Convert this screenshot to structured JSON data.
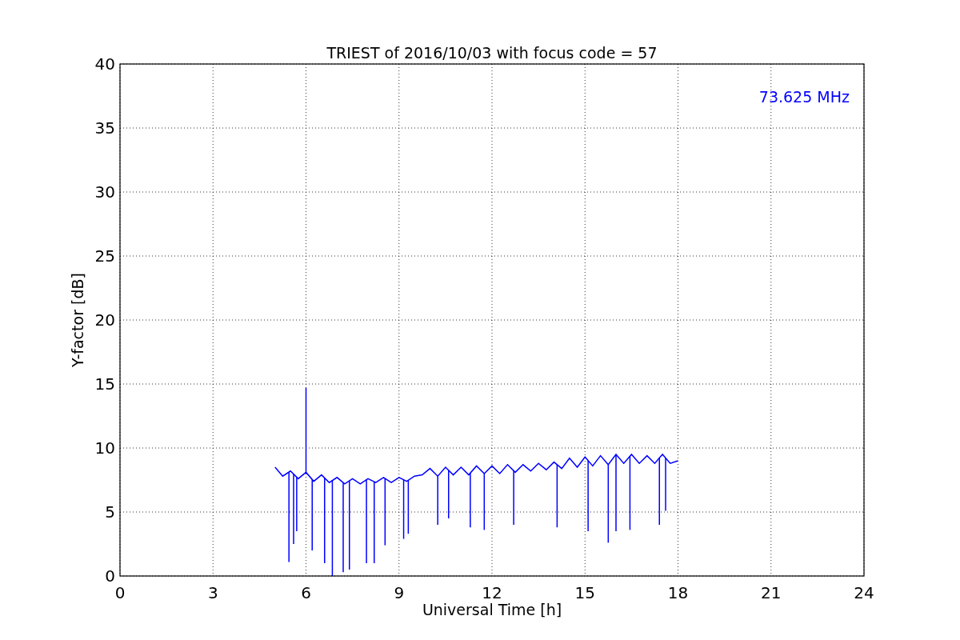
{
  "chart_data": {
    "type": "line",
    "title": "TRIEST of 2016/10/03 with focus code = 57",
    "xlabel": "Universal Time [h]",
    "ylabel": "Y-factor [dB]",
    "xlim": [
      0,
      24
    ],
    "ylim": [
      0,
      40
    ],
    "xticks": [
      0,
      3,
      6,
      9,
      12,
      15,
      18,
      21,
      24
    ],
    "yticks": [
      0,
      5,
      10,
      15,
      20,
      25,
      30,
      35,
      40
    ],
    "grid": true,
    "x": [
      5,
      5.25,
      5.5,
      5.75,
      6,
      6.25,
      6.5,
      6.75,
      7,
      7.25,
      7.5,
      7.75,
      8,
      8.25,
      8.5,
      8.75,
      9,
      9.25,
      9.5,
      9.75,
      10,
      10.25,
      10.5,
      10.75,
      11,
      11.25,
      11.5,
      11.75,
      12,
      12.25,
      12.5,
      12.75,
      13,
      13.25,
      13.5,
      13.75,
      14,
      14.25,
      14.5,
      14.75,
      15,
      15.25,
      15.5,
      15.75,
      16,
      16.25,
      16.5,
      16.75,
      17,
      17.25,
      17.5,
      17.75,
      18
    ],
    "series": [
      {
        "name": "73.625 MHz",
        "color": "#0000ff",
        "values": [
          8.5,
          7.8,
          8.2,
          7.6,
          8.1,
          7.4,
          7.9,
          7.3,
          7.7,
          7.2,
          7.6,
          7.2,
          7.6,
          7.3,
          7.7,
          7.3,
          7.7,
          7.4,
          7.8,
          7.9,
          8.4,
          7.8,
          8.5,
          7.9,
          8.5,
          7.9,
          8.6,
          8.0,
          8.6,
          8.0,
          8.7,
          8.1,
          8.7,
          8.2,
          8.8,
          8.3,
          8.9,
          8.4,
          9.2,
          8.5,
          9.3,
          8.6,
          9.4,
          8.7,
          9.5,
          8.8,
          9.5,
          8.8,
          9.4,
          8.8,
          9.5,
          8.8,
          9.0
        ]
      }
    ]
  }
}
